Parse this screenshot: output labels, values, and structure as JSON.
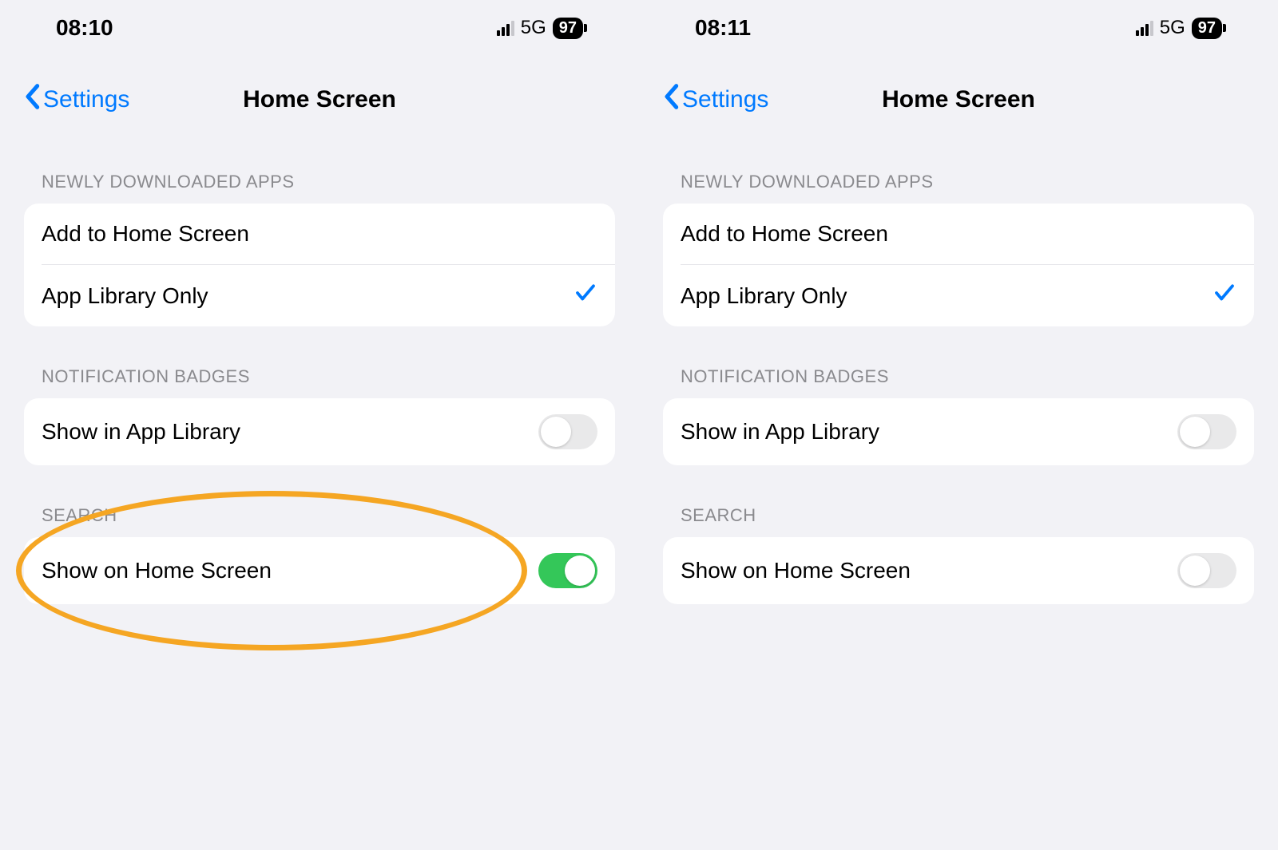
{
  "left": {
    "status": {
      "time": "08:10",
      "network": "5G",
      "battery": "97"
    },
    "nav": {
      "back_label": "Settings",
      "title": "Home Screen"
    },
    "sections": {
      "newly_downloaded": {
        "header": "NEWLY DOWNLOADED APPS",
        "add_option": "Add to Home Screen",
        "app_library_option": "App Library Only",
        "selected": "app_library"
      },
      "notification_badges": {
        "header": "NOTIFICATION BADGES",
        "show_in_app_library": "Show in App Library",
        "toggle_on": false
      },
      "search": {
        "header": "SEARCH",
        "show_on_home": "Show on Home Screen",
        "toggle_on": true
      }
    },
    "highlight": true
  },
  "right": {
    "status": {
      "time": "08:11",
      "network": "5G",
      "battery": "97"
    },
    "nav": {
      "back_label": "Settings",
      "title": "Home Screen"
    },
    "sections": {
      "newly_downloaded": {
        "header": "NEWLY DOWNLOADED APPS",
        "add_option": "Add to Home Screen",
        "app_library_option": "App Library Only",
        "selected": "app_library"
      },
      "notification_badges": {
        "header": "NOTIFICATION BADGES",
        "show_in_app_library": "Show in App Library",
        "toggle_on": false
      },
      "search": {
        "header": "SEARCH",
        "show_on_home": "Show on Home Screen",
        "toggle_on": false
      }
    },
    "highlight": false
  }
}
